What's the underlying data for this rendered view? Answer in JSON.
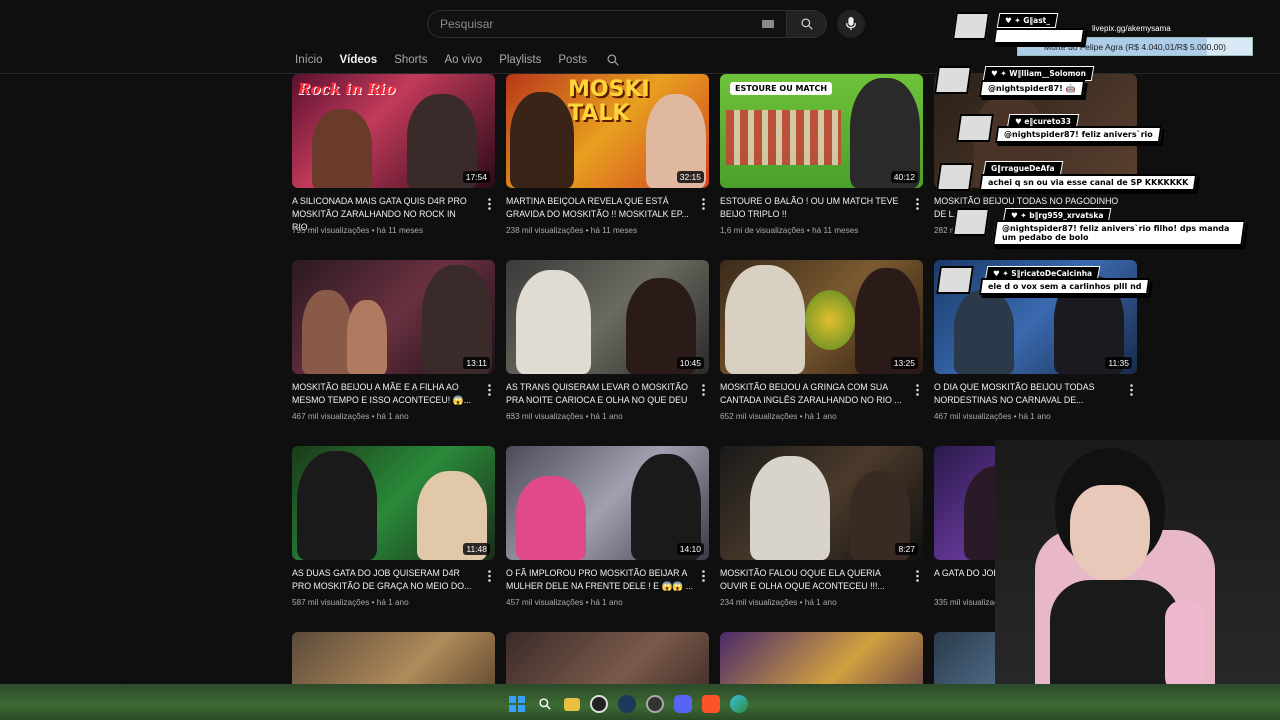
{
  "search": {
    "placeholder": "Pesquisar"
  },
  "tabs": [
    {
      "label": "Início",
      "active": false
    },
    {
      "label": "Vídeos",
      "active": true
    },
    {
      "label": "Shorts",
      "active": false
    },
    {
      "label": "Ao vivo",
      "active": false
    },
    {
      "label": "Playlists",
      "active": false
    },
    {
      "label": "Posts",
      "active": false
    }
  ],
  "videos": [
    {
      "title": "A SILICONADA MAIS GATA QUIS D4R PRO MOSKITÃO ZARALHANDO NO ROCK IN RIO...",
      "duration": "17:54",
      "views": "795 mil visualizações",
      "age": "há 11 meses",
      "thumb_overlay": "Rock in Rio"
    },
    {
      "title": "MARTINA BEIÇOLA REVELA QUE ESTÁ GRAVIDA DO MOSKITÃO !! MOSKITALK EP...",
      "duration": "32:15",
      "views": "238 mil visualizações",
      "age": "há 11 meses",
      "thumb_overlay": "MOSKI TALK"
    },
    {
      "title": "ESTOURE O BALÃO ! OU UM MATCH TEVE BEIJO TRIPLO !!",
      "duration": "40:12",
      "views": "1,6 mi de visualizações",
      "age": "há 11 meses",
      "thumb_overlay": "ESTOURE OU MATCH"
    },
    {
      "title": "MOSKITÃO BEIJOU TODAS NO PAGODINHO DE L...",
      "duration": "",
      "views": "282 m",
      "age": "",
      "thumb_overlay": ""
    },
    {
      "title": "MOSKITÃO BEIJOU A MÃE E A FILHA AO MESMO TEMPO E ISSO ACONTECEU! 😱...",
      "duration": "13:11",
      "views": "467 mil visualizações",
      "age": "há 1 ano",
      "thumb_overlay": ""
    },
    {
      "title": "AS TRANS QUISERAM LEVAR O MOSKITÃO PRA NOITE CARIOCA E OLHA NO QUE DEU ...",
      "duration": "10:45",
      "views": "633 mil visualizações",
      "age": "há 1 ano",
      "thumb_overlay": ""
    },
    {
      "title": "MOSKITÃO BEIJOU A GRINGA COM SUA CANTADA INGLÊS ZARALHANDO NO RIO ...",
      "duration": "13:25",
      "views": "652 mil visualizações",
      "age": "há 1 ano",
      "thumb_overlay": ""
    },
    {
      "title": "O DIA QUE MOSKITÃO BEIJOU TODAS NORDESTINAS NO CARNAVAL DE...",
      "duration": "11:35",
      "views": "467 mil visualizações",
      "age": "há 1 ano",
      "thumb_overlay": ""
    },
    {
      "title": "AS DUAS GATA DO JOB QUISERAM D4R PRO MOSKITÃO DE GRAÇA NO MEIO DO...",
      "duration": "11:48",
      "views": "587 mil visualizações",
      "age": "há 1 ano",
      "thumb_overlay": ""
    },
    {
      "title": "O FÃ IMPLOROU PRO MOSKITÃO BEIJAR A MULHER DELE NA FRENTE DELE ! E 😱😱 ...",
      "duration": "14:10",
      "views": "457 mil visualizações",
      "age": "há 1 ano",
      "thumb_overlay": ""
    },
    {
      "title": "MOSKITÃO FALOU OQUE ELA QUERIA OUVIR E OLHA OQUE ACONTECEU !!!...",
      "duration": "8:27",
      "views": "234 mil visualizações",
      "age": "há 1 ano",
      "thumb_overlay": ""
    },
    {
      "title": "A GATA DO JOB QU... DE GRAÇA NO ME...",
      "duration": "",
      "views": "335 mil visualizações",
      "age": "",
      "thumb_overlay": ""
    }
  ],
  "overlay": {
    "livepix": "livepix.gg/akemysama",
    "goal": {
      "label": "Morte do Felipe Agra (R$ 4.040,01/R$ 5.000,00)",
      "progress": 0.808
    },
    "chat": [
      {
        "user": "♥ ✦ G‖ast_",
        "message": ""
      },
      {
        "user": "♥ ✦ W‖lliam__Solomon",
        "message": "@nightspider87! 🤖"
      },
      {
        "user": "♥ e‖cureto33",
        "message": "@nightspider87! feliz anivers`rio"
      },
      {
        "user": "G‖rragueDeAfa",
        "message": "achei q sn ou via esse canal de SP KKKKKKK"
      },
      {
        "user": "♥ ✦ b‖rg959_xrvatska",
        "message": "@nightspider87! feliz anivers`rio filho! dps manda um pedabo de bolo"
      },
      {
        "user": "♥ ✦ S‖ricatoDeCalcinha",
        "message": "ele d o vox sem a carlinhos plll nd"
      }
    ]
  },
  "colors": {
    "bg": "#0f0f0f",
    "text": "#f1f1f1",
    "meta": "#aaaaaa"
  }
}
